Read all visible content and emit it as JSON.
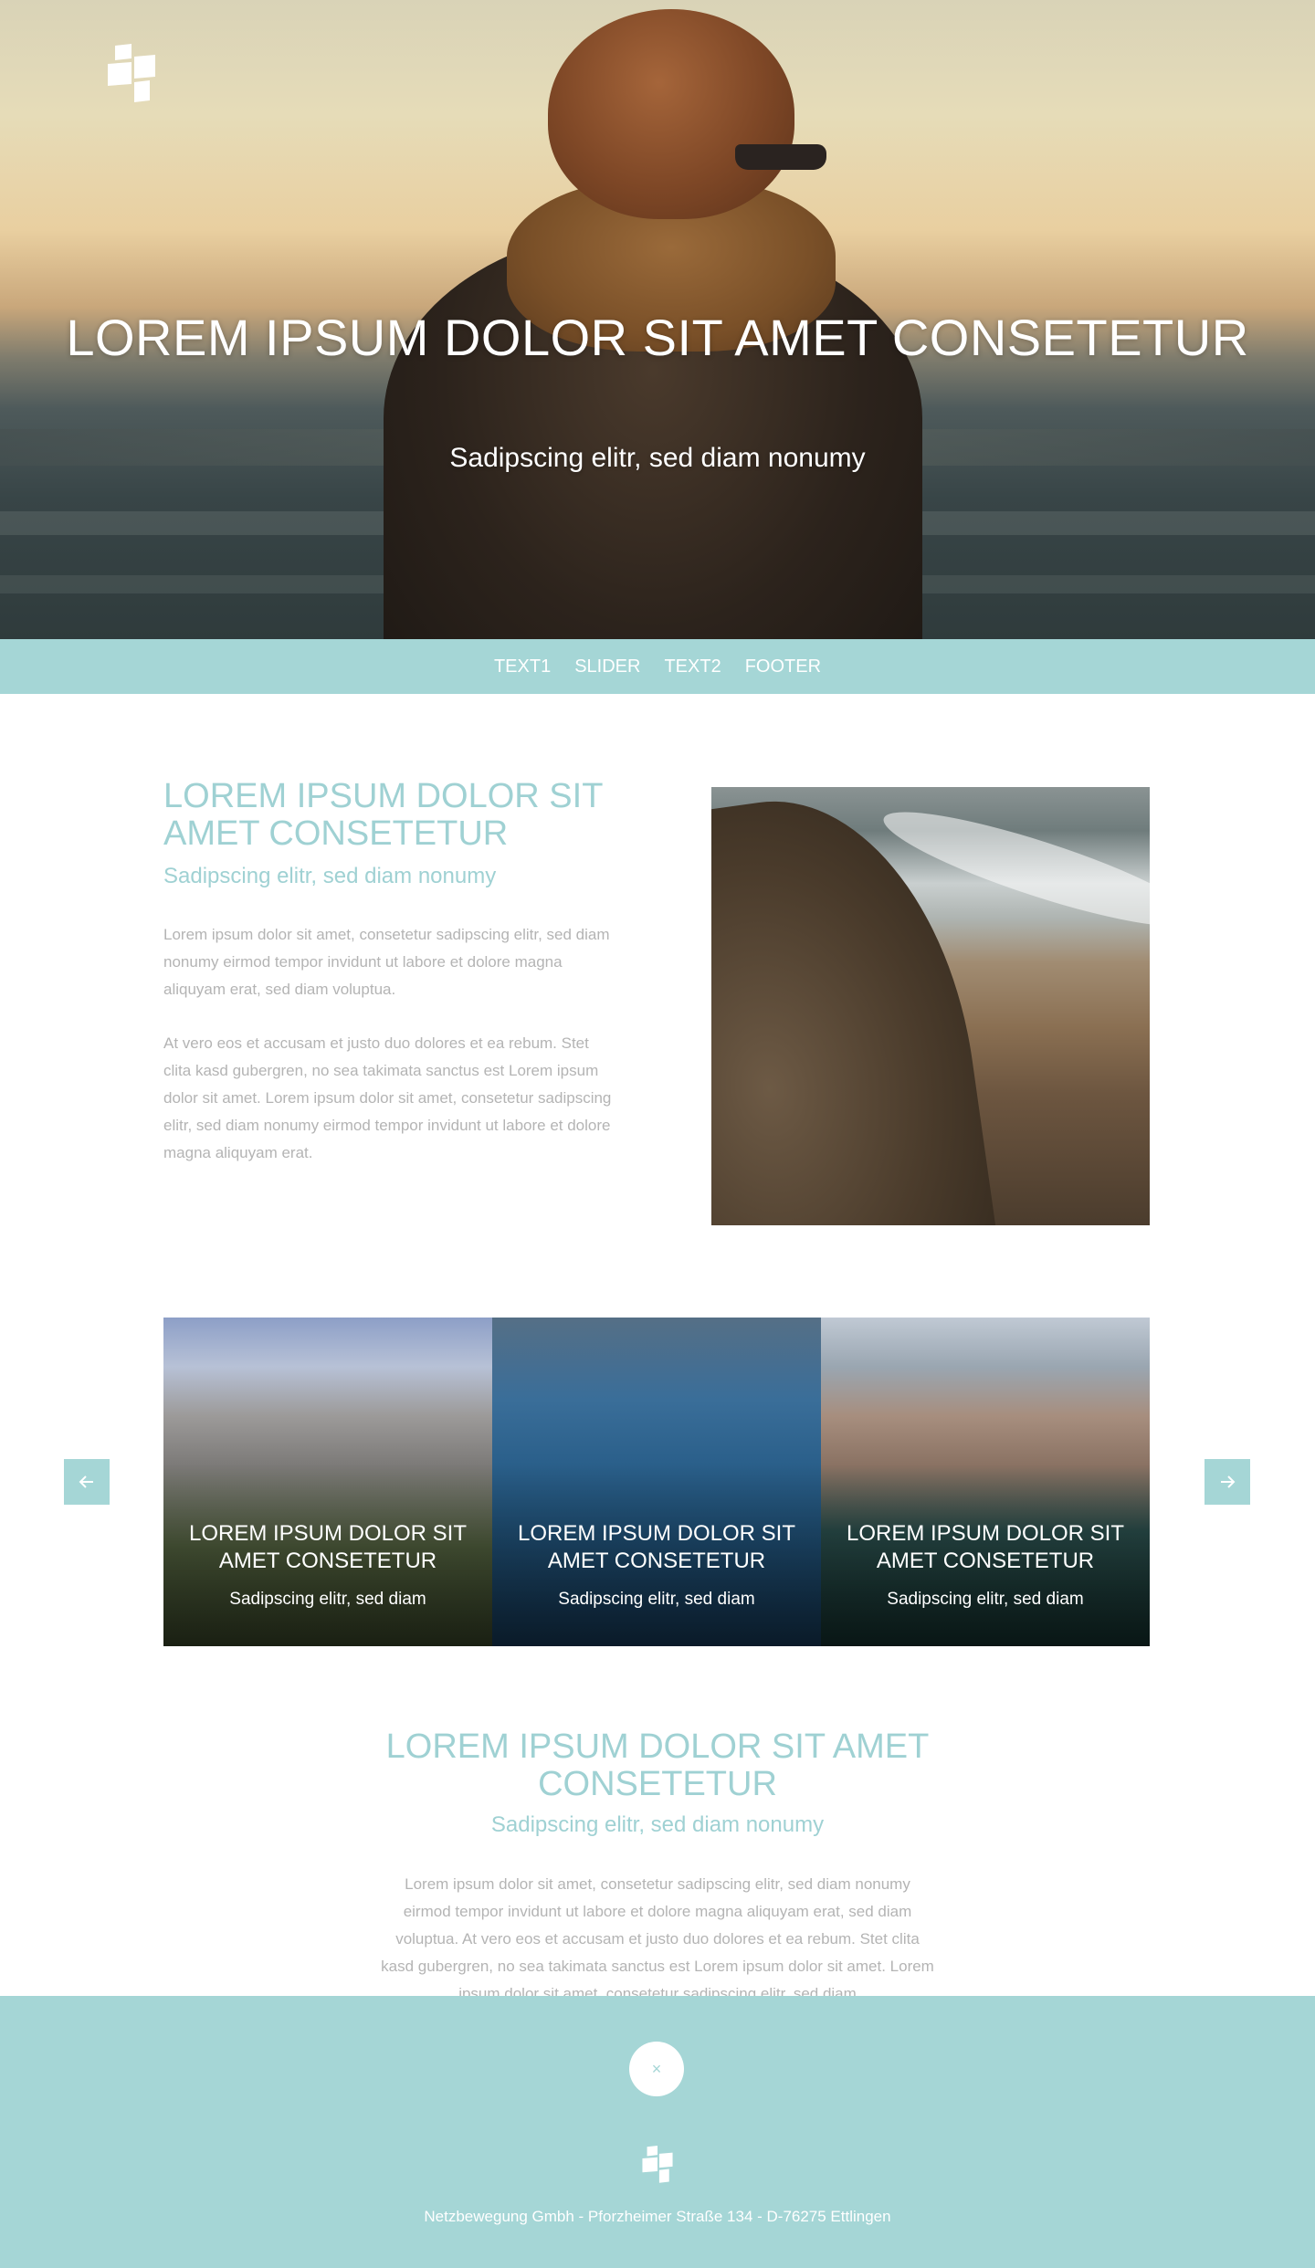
{
  "colors": {
    "accent": "#a5d6d6",
    "heading": "#9fd1d3",
    "body_text": "#b4b4b4",
    "white": "#ffffff"
  },
  "hero": {
    "logo_icon": "blocks-logo-icon",
    "title": "LOREM IPSUM DOLOR SIT AMET CONSETETUR",
    "subtitle": "Sadipscing elitr, sed diam nonumy"
  },
  "nav": {
    "items": [
      {
        "label": "TEXT1"
      },
      {
        "label": "SLIDER"
      },
      {
        "label": "TEXT2"
      },
      {
        "label": "FOOTER"
      }
    ]
  },
  "text1": {
    "title": "LOREM IPSUM DOLOR SIT AMET CONSETETUR",
    "subtitle": "Sadipscing elitr, sed diam nonumy",
    "paragraphs": [
      "Lorem ipsum dolor sit amet, consetetur sadipscing elitr, sed diam nonumy eirmod tempor invidunt ut labore et dolore magna aliquyam erat, sed diam voluptua.",
      "At vero eos et accusam et justo duo dolores et ea rebum. Stet clita kasd gubergren, no sea takimata sanctus est Lorem ipsum dolor sit amet. Lorem ipsum dolor sit amet, consetetur sadipscing elitr, sed diam nonumy eirmod tempor invidunt ut labore et dolore magna aliquyam erat."
    ]
  },
  "slider": {
    "prev_icon": "arrow-left-icon",
    "next_icon": "arrow-right-icon",
    "slides": [
      {
        "title": "LOREM IPSUM DOLOR SIT AMET CONSETETUR",
        "subtitle": "Sadipscing elitr, sed diam"
      },
      {
        "title": "LOREM IPSUM DOLOR SIT AMET CONSETETUR",
        "subtitle": "Sadipscing elitr, sed diam"
      },
      {
        "title": "LOREM IPSUM DOLOR SIT AMET CONSETETUR",
        "subtitle": "Sadipscing elitr, sed diam"
      }
    ]
  },
  "text2": {
    "title": "LOREM IPSUM DOLOR SIT AMET CONSETETUR",
    "subtitle": "Sadipscing elitr, sed diam nonumy",
    "paragraph": "Lorem ipsum dolor sit amet, consetetur sadipscing elitr, sed diam nonumy eirmod tempor invidunt ut labore et dolore magna aliquyam erat, sed diam voluptua. At vero eos et accusam et justo duo dolores et ea rebum. Stet clita kasd gubergren, no sea takimata sanctus est Lorem ipsum dolor sit amet. Lorem ipsum dolor sit amet, consetetur sadipscing elitr, sed diam"
  },
  "footer": {
    "close_label": "×",
    "logo_icon": "blocks-logo-icon",
    "address": "Netzbewegung Gmbh - Pforzheimer Straße 134 - D-76275 Ettlingen"
  }
}
